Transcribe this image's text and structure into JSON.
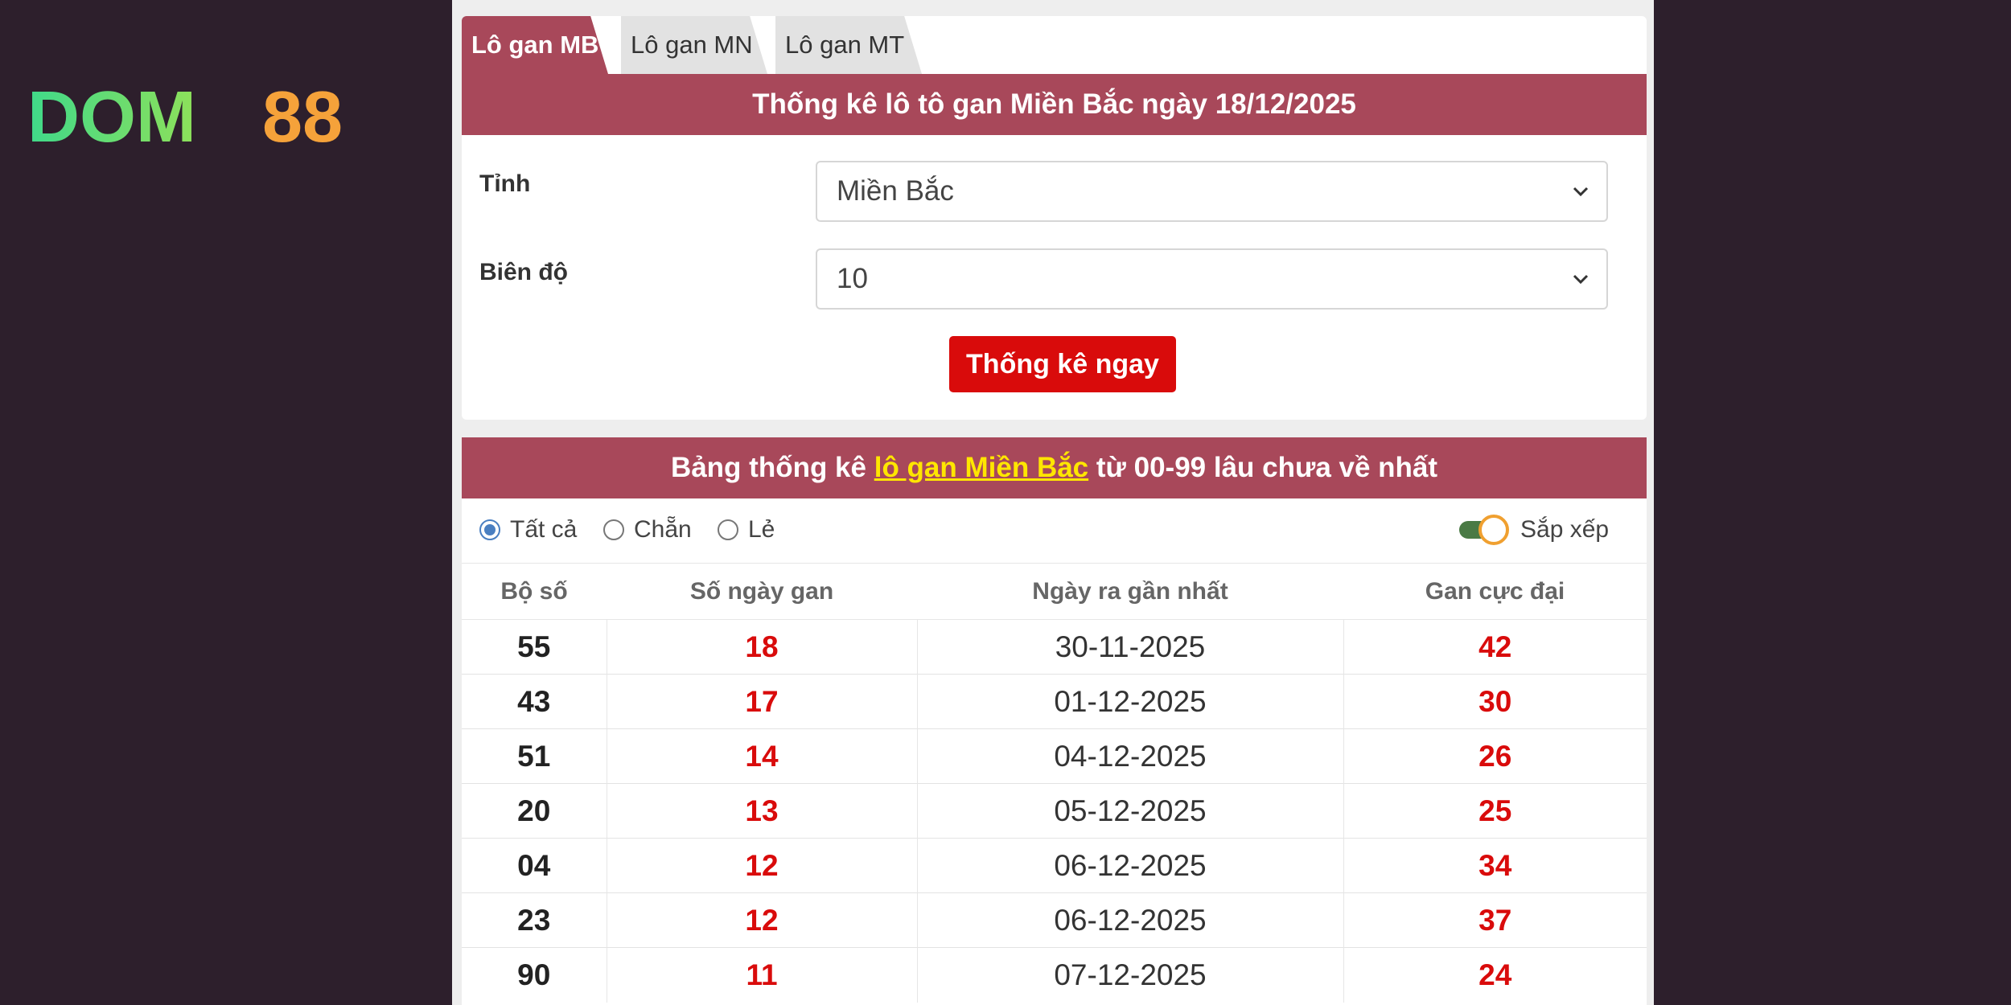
{
  "brand": {
    "name": "DOM88",
    "left": "DOM",
    "right": "88"
  },
  "tabs": [
    {
      "label": "Lô gan MB"
    },
    {
      "label": "Lô gan MN"
    },
    {
      "label": "Lô gan MT"
    }
  ],
  "form": {
    "title": "Thống kê lô tô gan Miền Bắc ngày 18/12/2025",
    "province_label": "Tỉnh",
    "province_value": "Miền Bắc",
    "range_label": "Biên độ",
    "range_value": "10",
    "submit_label": "Thống kê ngay"
  },
  "stats": {
    "heading_pre": "Bảng thống kê ",
    "heading_link": "lô gan Miền Bắc",
    "heading_post": " từ 00-99 lâu chưa về nhất",
    "filter_all": "Tất cả",
    "filter_even": "Chẵn",
    "filter_odd": "Lẻ",
    "sort_label": "Sắp xếp",
    "columns": [
      "Bộ số",
      "Số ngày gan",
      "Ngày ra gần nhất",
      "Gan cực đại"
    ],
    "rows": [
      {
        "number": "55",
        "days": "18",
        "last_date": "30-11-2025",
        "max_gan": "42"
      },
      {
        "number": "43",
        "days": "17",
        "last_date": "01-12-2025",
        "max_gan": "30"
      },
      {
        "number": "51",
        "days": "14",
        "last_date": "04-12-2025",
        "max_gan": "26"
      },
      {
        "number": "20",
        "days": "13",
        "last_date": "05-12-2025",
        "max_gan": "25"
      },
      {
        "number": "04",
        "days": "12",
        "last_date": "06-12-2025",
        "max_gan": "34"
      },
      {
        "number": "23",
        "days": "12",
        "last_date": "06-12-2025",
        "max_gan": "37"
      },
      {
        "number": "90",
        "days": "11",
        "last_date": "07-12-2025",
        "max_gan": "24"
      }
    ]
  },
  "colors": {
    "accent": "#a8485a",
    "button": "#d90b0b",
    "background": "#2d1f2c",
    "highlight": "#ffe600"
  }
}
